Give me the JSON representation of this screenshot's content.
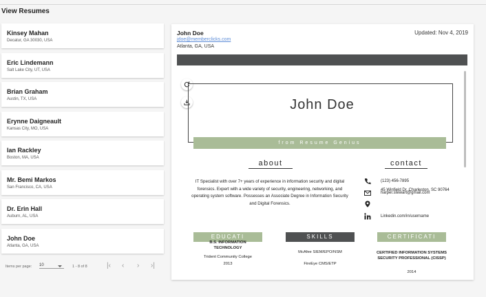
{
  "page": {
    "title": "View Resumes"
  },
  "resumes": [
    {
      "name": "Kinsey Mahan",
      "location": "Decatur, GA 30030, USA"
    },
    {
      "name": "Eric Lindemann",
      "location": "Salt Lake City, UT, USA"
    },
    {
      "name": "Brian Graham",
      "location": "Austin, TX, USA"
    },
    {
      "name": "Erynne Daigneault",
      "location": "Kansas City, MO, USA"
    },
    {
      "name": "Ian Rackley",
      "location": "Boston, MA, USA"
    },
    {
      "name": "Mr. Bemi Markos",
      "location": "San Francisco, CA, USA"
    },
    {
      "name": "Dr. Erin Hall",
      "location": "Auburn, AL, USA"
    },
    {
      "name": "John Doe",
      "location": "Atlanta, GA, USA"
    }
  ],
  "pagination": {
    "items_label": "Items per page:",
    "page_size": "10",
    "range": "1 - 8 of 8",
    "first_icon": "first-page-icon",
    "prev_icon": "chevron-left-icon",
    "next_icon": "chevron-right-icon",
    "last_icon": "last-page-icon"
  },
  "detail": {
    "name": "John Doe",
    "email": "jdoe@memberclicks.com",
    "location": "Atlanta, GA, USA",
    "updated": "Updated: Nov 4, 2019"
  },
  "viewer": {
    "refresh_icon": "refresh-icon",
    "download_icon": "download-icon"
  },
  "document": {
    "name": "John Doe",
    "banner": "from Resume Genius",
    "about_heading": "about",
    "contact_heading": "contact",
    "about_text": "IT Specialist with over 7+ years of experience in information security and digital forensics. Expert with a wide variety of security, engineering, networking, and operating system software. Possesses an Associate Degree in Information Security and Digital Forensics.",
    "contact": {
      "phone": "(123) 456-7895",
      "email": "harper.stewart@gmail.com",
      "address": "45 Winfield Dr. Charleston, SC 90764",
      "linkedin": "Linkedin.com/in/username"
    },
    "education": {
      "heading": "EDUCATI",
      "degree": "B.S. INFORMATION TECHNOLOGY",
      "school": "Trident Community College",
      "year": "2013"
    },
    "skills": {
      "heading": "SKILLS",
      "items": [
        "McAfee SIEM/EPO/NSM",
        "FireEye CMS/ETP"
      ]
    },
    "certifications": {
      "heading": "CERTIFICATI",
      "name": "CERTIFIED INFORMATION SYSTEMS SECURITY PROFESSIONAL (CISSP)",
      "year": "2014"
    }
  },
  "colors": {
    "accent_green": "#a9bc97",
    "dark_bar": "#4f5152",
    "link": "#5b8bd6"
  }
}
